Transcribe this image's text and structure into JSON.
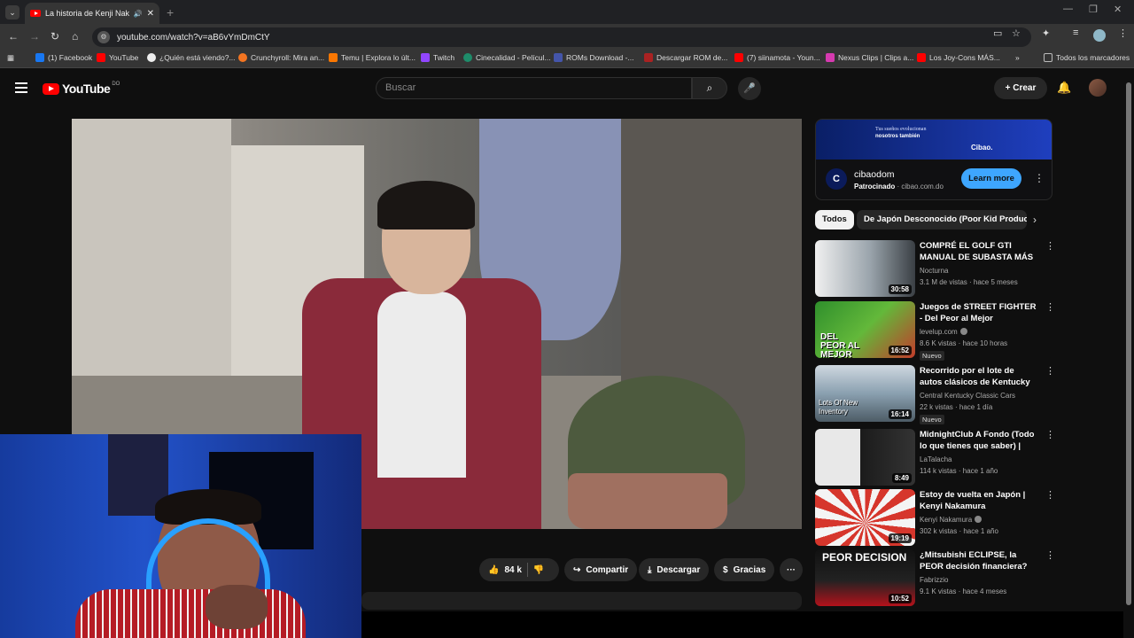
{
  "browser": {
    "tab_title": "La historia de Kenji Nakamura",
    "url": "youtube.com/watch?v=aB6vYmDmCtY",
    "bookmarks": [
      {
        "label": "(1) Facebook",
        "color": "#1877f2"
      },
      {
        "label": "YouTube",
        "color": "#ff0000"
      },
      {
        "label": "¿Quién está viendo?...",
        "color": "#eeeeee"
      },
      {
        "label": "Crunchyroll: Mira an...",
        "color": "#f47521"
      },
      {
        "label": "Temu | Explora lo últ...",
        "color": "#fb7701"
      },
      {
        "label": "Twitch",
        "color": "#9146ff"
      },
      {
        "label": "Cinecalidad - Películ...",
        "color": "#1e8c6a"
      },
      {
        "label": "ROMs Download -...",
        "color": "#4455aa"
      },
      {
        "label": "Descargar ROM de...",
        "color": "#aa2222"
      },
      {
        "label": "(7) siinamota - Youn...",
        "color": "#ff0000"
      },
      {
        "label": "Nexus Clips | Clips a...",
        "color": "#d63ab0"
      },
      {
        "label": "Los Joy-Cons MÁS...",
        "color": "#ff0000"
      }
    ],
    "all_bookmarks": "Todos los marcadores"
  },
  "youtube": {
    "logo_text": "YouTube",
    "country": "DO",
    "search_placeholder": "Buscar",
    "create_label": "Crear"
  },
  "actions": {
    "likes": "84 k",
    "share": "Compartir",
    "download": "Descargar",
    "thanks": "Gracias"
  },
  "ad": {
    "banner_line1": "Tus sueños evolucionan",
    "banner_line2": "nosotros también",
    "banner_brand": "Cibao.",
    "name": "cibaodom",
    "sponsored": "Patrocinado",
    "domain": "· cibao.com.do",
    "cta": "Learn more"
  },
  "chips": [
    "Todos",
    "De Japón Desconocido (Poor Kid Productions)"
  ],
  "recommendations": [
    {
      "title": "COMPRÉ EL GOLF GTI MANUAL DE SUBASTA MÁS BARATO D...",
      "channel": "Nocturna",
      "verified": false,
      "meta": "3.1 M de vistas · hace 5 meses",
      "duration": "30:58",
      "new": "",
      "thumb": "#6d7a86"
    },
    {
      "title": "Juegos de STREET FIGHTER - Del Peor al Mejor",
      "channel": "levelup.com",
      "verified": true,
      "meta": "8.6 K vistas · hace 10 horas",
      "duration": "16:52",
      "new": "Nuevo",
      "thumb": "#3f9a3a"
    },
    {
      "title": "Recorrido por el lote de autos clásicos de Kentucky central, ...",
      "channel": "Central Kentucky Classic Cars",
      "verified": false,
      "meta": "22 k vistas · hace 1 día",
      "duration": "16:14",
      "new": "Nuevo",
      "thumb": "#7a8fa0"
    },
    {
      "title": "MidnightClub A Fondo (Todo lo que tienes que saber) | Kenyi ...",
      "channel": "LaTalacha",
      "verified": false,
      "meta": "114 k vistas · hace 1 año",
      "duration": "8:49",
      "new": "",
      "thumb": "#d8d8d8"
    },
    {
      "title": "Estoy de vuelta en Japón | Kenyi Nakamura",
      "channel": "Kenyi Nakamura",
      "verified": true,
      "meta": "302 k vistas · hace 1 año",
      "duration": "19:19",
      "new": "",
      "thumb": "#c8392e"
    },
    {
      "title": "¿Mitsubishi ECLIPSE, la PEOR decisión financiera? 😮💸",
      "channel": "Fabrizzio",
      "verified": false,
      "meta": "9.1 K vistas · hace 4 meses",
      "duration": "10:52",
      "new": "",
      "thumb": "#1a1a1a"
    }
  ],
  "thumb_text": {
    "r1": "DEL PEOR AL MEJOR",
    "r2": "Lots Of New Inventory",
    "r5": "PEOR DECISION"
  }
}
